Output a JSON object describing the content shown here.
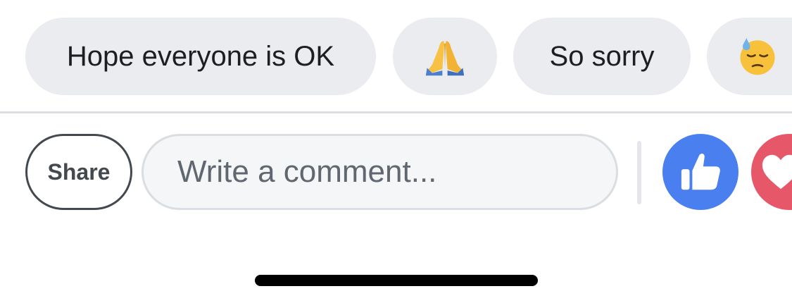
{
  "quick_replies": {
    "items": [
      {
        "label": "Hope everyone is OK"
      },
      {
        "emoji": "folded-hands-emoji"
      },
      {
        "label": "So sorry"
      },
      {
        "emoji": "downcast-face-with-sweat-emoji"
      }
    ]
  },
  "comment_bar": {
    "share_label": "Share",
    "comment_placeholder": "Write a comment...",
    "like_icon": "thumbs-up-icon",
    "love_icon": "heart-icon",
    "like_color": "#4a7ff0",
    "love_color": "#e7576a"
  }
}
